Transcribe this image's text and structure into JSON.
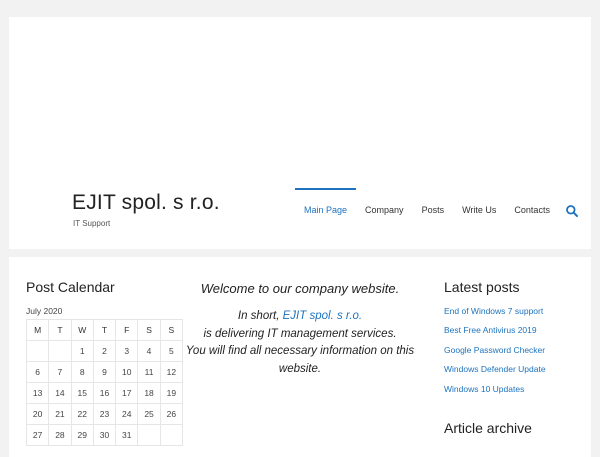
{
  "header": {
    "title": "EJIT spol. s r.o.",
    "tagline": "IT Support"
  },
  "nav": {
    "items": [
      {
        "label": "Main Page",
        "active": true
      },
      {
        "label": "Company",
        "active": false
      },
      {
        "label": "Posts",
        "active": false
      },
      {
        "label": "Write Us",
        "active": false
      },
      {
        "label": "Contacts",
        "active": false
      }
    ],
    "search_icon": "search-icon"
  },
  "calendar": {
    "title": "Post Calendar",
    "caption": "July 2020",
    "weekdays": [
      "M",
      "T",
      "W",
      "T",
      "F",
      "S",
      "S"
    ],
    "weeks": [
      [
        "",
        "",
        "1",
        "2",
        "3",
        "4",
        "5"
      ],
      [
        "6",
        "7",
        "8",
        "9",
        "10",
        "11",
        "12"
      ],
      [
        "13",
        "14",
        "15",
        "16",
        "17",
        "18",
        "19"
      ],
      [
        "20",
        "21",
        "22",
        "23",
        "24",
        "25",
        "26"
      ],
      [
        "27",
        "28",
        "29",
        "30",
        "31",
        "",
        ""
      ]
    ]
  },
  "main": {
    "welcome": "Welcome to our company website.",
    "line1_prefix": "In short, ",
    "line1_link": "EJIT spol. s r.o.",
    "line2": "is delivering IT management services.",
    "line3": "You will find all necessary information on this website."
  },
  "latest_posts": {
    "title": "Latest posts",
    "items": [
      "End of Windows 7 support",
      "Best Free Antivirus 2019",
      "Google Password Checker",
      "Windows Defender Update",
      "Windows 10 Updates"
    ]
  },
  "archive": {
    "title": "Article archive"
  },
  "colors": {
    "accent": "#1e73be",
    "background": "#f2f2f2"
  }
}
